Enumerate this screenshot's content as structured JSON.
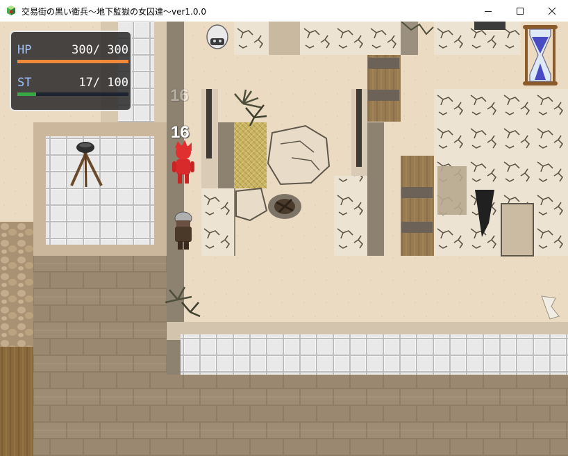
{
  "window": {
    "title": "交易街の黒い衛兵～地下監獄の女囚達～ver1.0.0",
    "icons": {
      "app": "game-app-icon",
      "minimize": "minimize-icon",
      "maximize": "maximize-icon",
      "close": "close-icon"
    }
  },
  "hud": {
    "hp": {
      "label": "HP",
      "value_text": "300/ 300",
      "current": 300,
      "max": 300,
      "color": "#f08a3a"
    },
    "st": {
      "label": "ST",
      "value_text": "17/ 100",
      "current": 17,
      "max": 100,
      "color": "#35a845"
    }
  },
  "damage_popups": [
    "16",
    "16"
  ],
  "icons": {
    "timer": "hourglass-icon"
  }
}
